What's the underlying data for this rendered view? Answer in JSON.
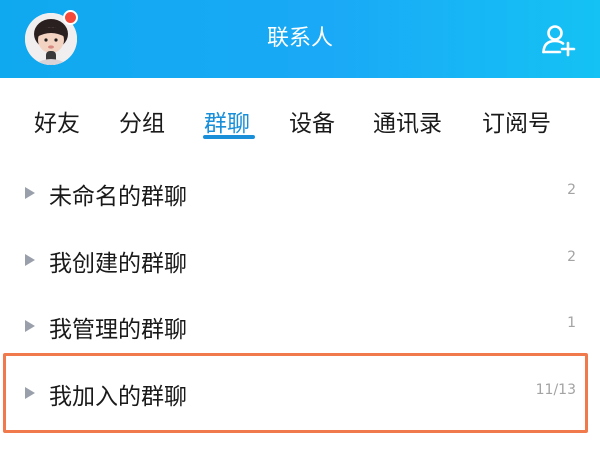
{
  "header": {
    "title": "联系人",
    "avatar_icon": "user-avatar",
    "has_notification_dot": true,
    "notification_dot_color": "#f5493a",
    "add_contact_icon": "add-user-icon",
    "background_color": "#12aaf2"
  },
  "tabs": [
    {
      "label": "好友",
      "active": false
    },
    {
      "label": "分组",
      "active": false
    },
    {
      "label": "群聊",
      "active": true
    },
    {
      "label": "设备",
      "active": false
    },
    {
      "label": "通讯录",
      "active": false
    },
    {
      "label": "订阅号",
      "active": false
    }
  ],
  "active_tab_color": "#1a8fd9",
  "groups": [
    {
      "label": "未命名的群聊",
      "count": "2"
    },
    {
      "label": "我创建的群聊",
      "count": "2"
    },
    {
      "label": "我管理的群聊",
      "count": "1"
    },
    {
      "label": "我加入的群聊",
      "count": "11/13",
      "highlighted": true
    }
  ],
  "highlight_color": "#f07a4c"
}
